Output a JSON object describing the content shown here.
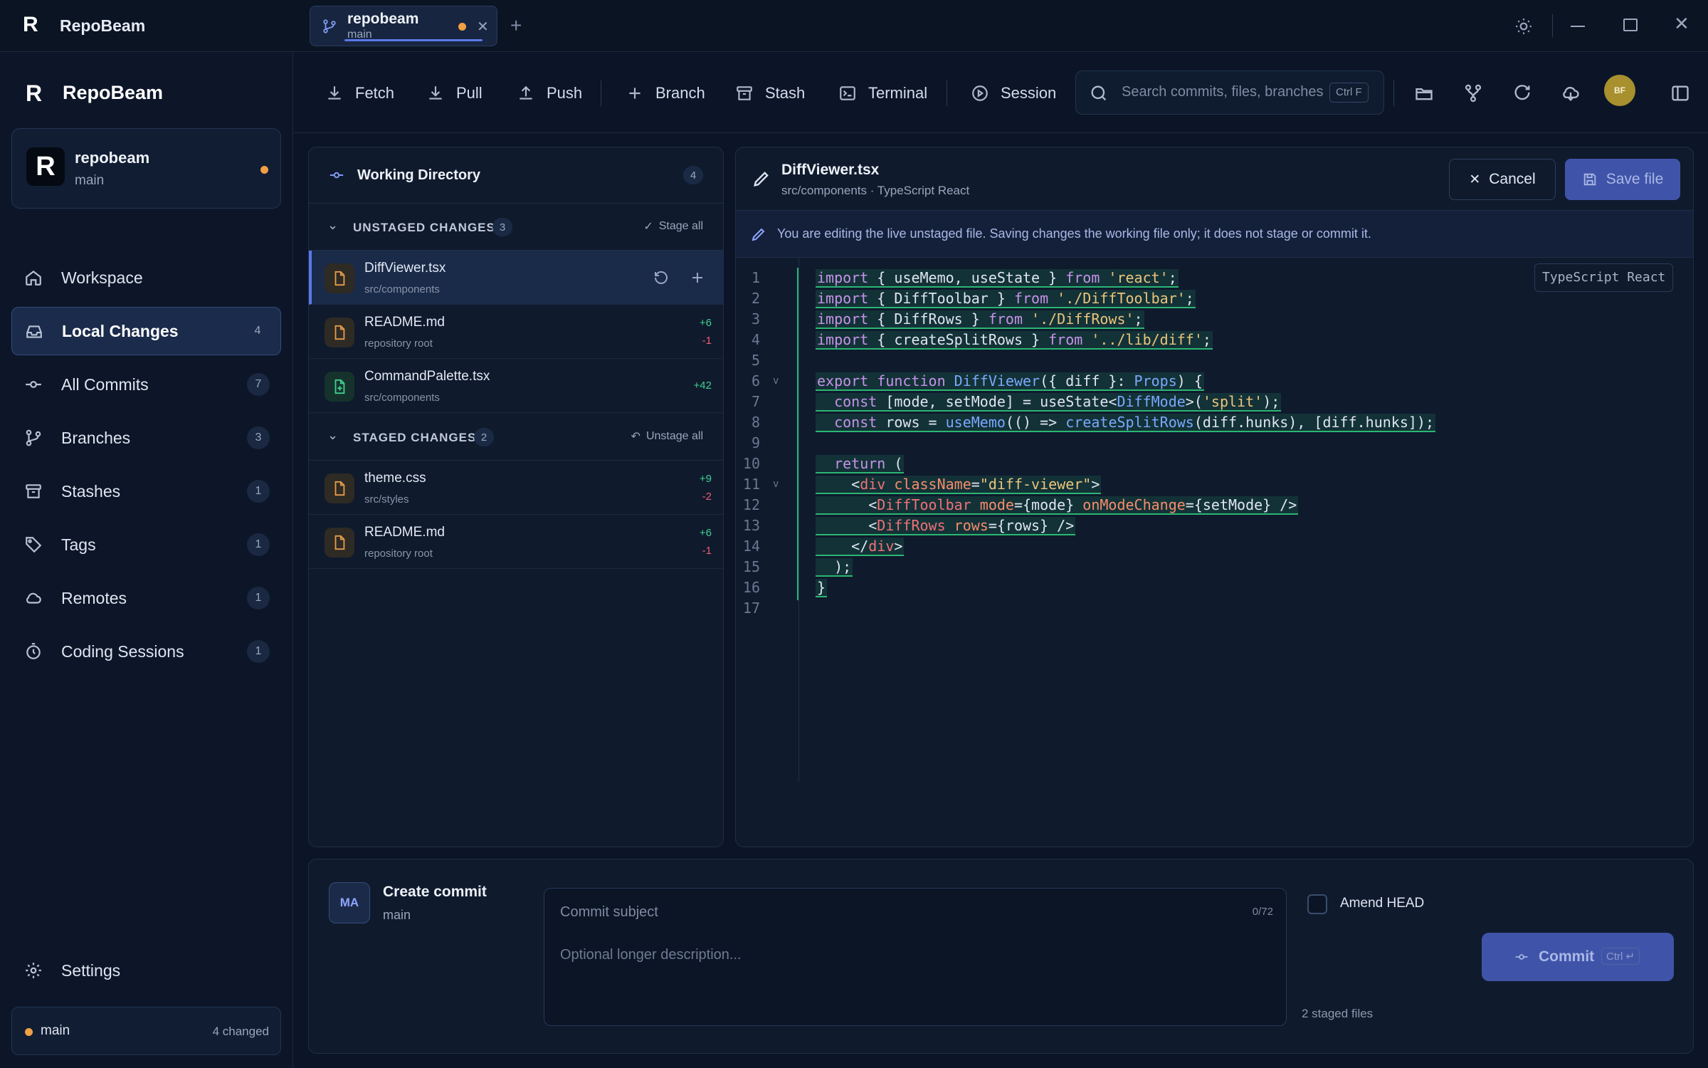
{
  "app": {
    "name": "RepoBeam",
    "tab": {
      "repo": "repobeam",
      "branch": "main"
    }
  },
  "sidebar": {
    "brand": "RepoBeam",
    "repo": {
      "name": "repobeam",
      "branch": "main"
    },
    "items": [
      {
        "label": "Workspace",
        "count": "",
        "icon": "home-icon",
        "active": false
      },
      {
        "label": "Local Changes",
        "count": "4",
        "icon": "inbox-icon",
        "active": true
      },
      {
        "label": "All Commits",
        "count": "7",
        "icon": "commit-icon",
        "active": false
      },
      {
        "label": "Branches",
        "count": "3",
        "icon": "branch-icon",
        "active": false
      },
      {
        "label": "Stashes",
        "count": "1",
        "icon": "archive-icon",
        "active": false
      },
      {
        "label": "Tags",
        "count": "1",
        "icon": "tag-icon",
        "active": false
      },
      {
        "label": "Remotes",
        "count": "1",
        "icon": "cloud-icon",
        "active": false
      },
      {
        "label": "Coding Sessions",
        "count": "1",
        "icon": "timer-icon",
        "active": false
      }
    ],
    "settings": "Settings",
    "status": {
      "branch": "main",
      "changed": "4 changed"
    }
  },
  "toolbar": {
    "fetch": "Fetch",
    "pull": "Pull",
    "push": "Push",
    "branch": "Branch",
    "stash": "Stash",
    "terminal": "Terminal",
    "session": "Session",
    "search_placeholder": "Search commits, files, branches",
    "search_shortcut": "Ctrl F",
    "avatar": "BF"
  },
  "working_directory": {
    "title": "Working Directory",
    "count": "4",
    "unstaged": {
      "title": "UNSTAGED CHANGES",
      "count": "3",
      "action": "Stage all",
      "files": [
        {
          "name": "DiffViewer.tsx",
          "path": "src/components",
          "add": "",
          "del": ""
        },
        {
          "name": "README.md",
          "path": "repository root",
          "add": "+6",
          "del": "-1"
        },
        {
          "name": "CommandPalette.tsx",
          "path": "src/components",
          "add": "+42",
          "del": ""
        }
      ]
    },
    "staged": {
      "title": "STAGED CHANGES",
      "count": "2",
      "action": "Unstage all",
      "files": [
        {
          "name": "theme.css",
          "path": "src/styles",
          "add": "+9",
          "del": "-2"
        },
        {
          "name": "README.md",
          "path": "repository root",
          "add": "+6",
          "del": "-1"
        }
      ]
    }
  },
  "editor": {
    "file": "DiffViewer.tsx",
    "subtitle": "src/components · TypeScript React",
    "cancel": "Cancel",
    "save": "Save file",
    "notice": "You are editing the live unstaged file. Saving changes the working file only; it does not stage or commit it.",
    "language": "TypeScript React",
    "line_numbers": [
      "1",
      "2",
      "3",
      "4",
      "5",
      "6",
      "7",
      "8",
      "9",
      "10",
      "11",
      "12",
      "13",
      "14",
      "15",
      "16",
      "17"
    ]
  },
  "commit": {
    "avatar": "MA",
    "title": "Create commit",
    "branch": "main",
    "subject_placeholder": "Commit subject",
    "subject_counter": "0/72",
    "description_placeholder": "Optional longer description...",
    "amend": "Amend HEAD",
    "button": "Commit",
    "shortcut": "Ctrl ↵",
    "staged_info": "2 staged files"
  },
  "colors": {
    "accent": "#5b78e8",
    "addition": "#3fcf8e",
    "deletion": "#ef5b6a",
    "modified": "#e69b4c",
    "background": "#0b1527"
  }
}
